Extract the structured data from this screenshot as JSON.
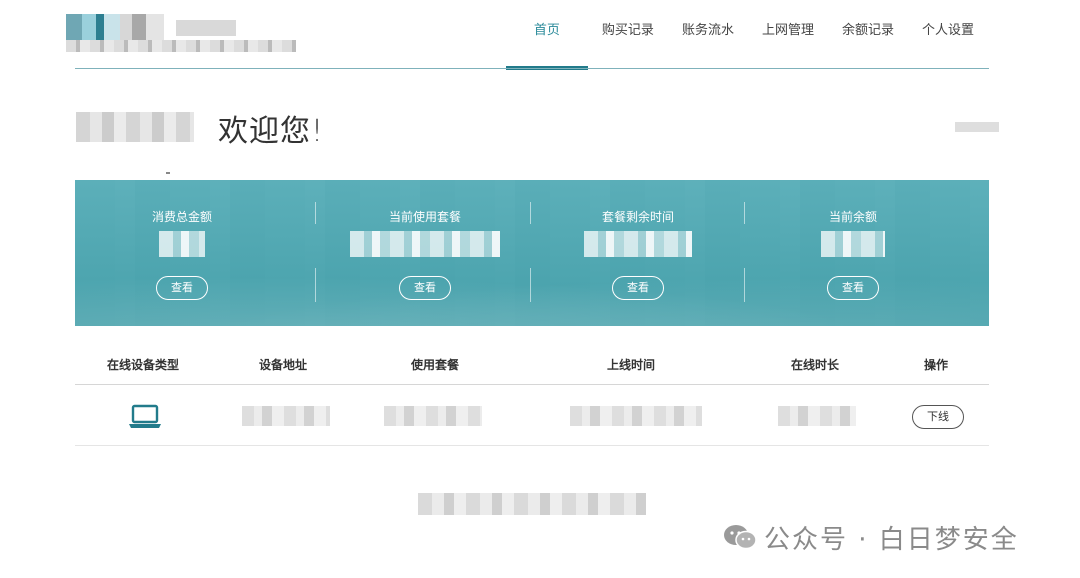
{
  "nav": {
    "items": [
      {
        "label": "首页",
        "active": true
      },
      {
        "label": "购买记录",
        "active": false
      },
      {
        "label": "账务流水",
        "active": false
      },
      {
        "label": "上网管理",
        "active": false
      },
      {
        "label": "余额记录",
        "active": false
      },
      {
        "label": "个人设置",
        "active": false
      }
    ]
  },
  "welcome": {
    "text": "欢迎您!"
  },
  "stats": [
    {
      "label": "消费总金额",
      "button": "查看"
    },
    {
      "label": "当前使用套餐",
      "button": "查看"
    },
    {
      "label": "套餐剩余时间",
      "button": "查看"
    },
    {
      "label": "当前余额",
      "button": "查看"
    }
  ],
  "table": {
    "columns": [
      "在线设备类型",
      "设备地址",
      "使用套餐",
      "上线时间",
      "在线时长",
      "操作"
    ],
    "rows": [
      {
        "device_icon": "laptop-icon",
        "action": "下线"
      }
    ]
  },
  "watermark": {
    "text": "公众号 · 白日梦安全",
    "icon": "wechat-icon"
  },
  "colors": {
    "accent": "#227b8b",
    "banner": "#5ab1bb"
  }
}
